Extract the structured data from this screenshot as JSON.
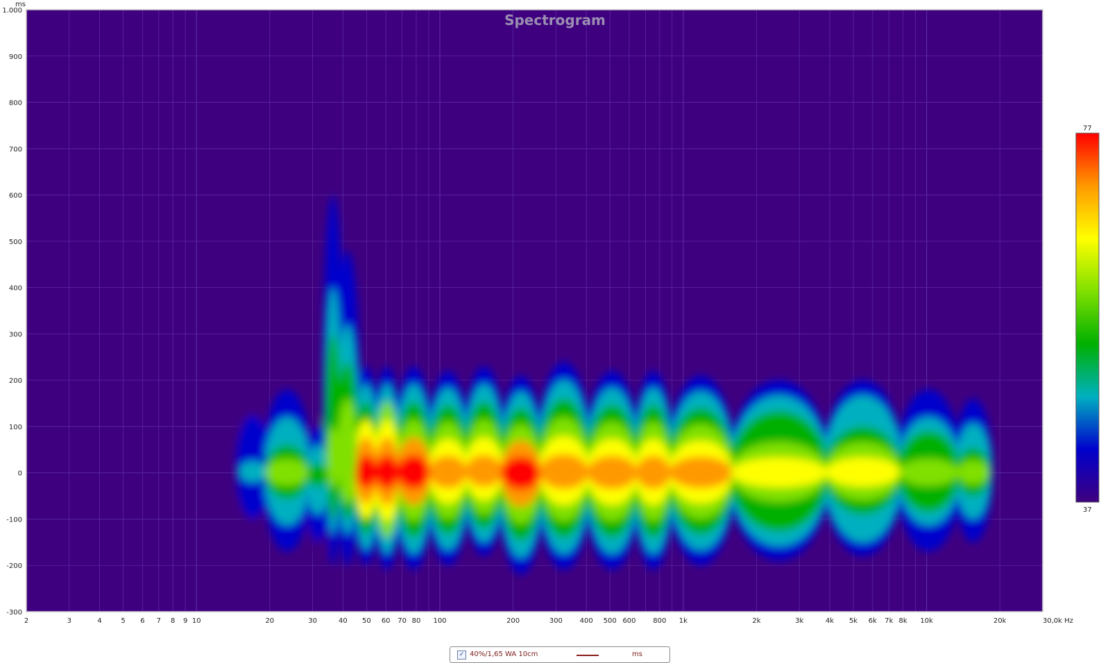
{
  "window": {
    "title": "Spectrogram"
  },
  "colors": {
    "background": "#3f007f",
    "grid": "#5a2aa0",
    "title": "#9a8fb2",
    "curve_legend": "#8b1a1a"
  },
  "chart_data": {
    "type": "heatmap",
    "title": "Spectrogram",
    "xlabel": "Hz",
    "ylabel": "ms",
    "x_scale": "log",
    "xlim": [
      2,
      30000
    ],
    "ylim": [
      -300,
      1000
    ],
    "x_ticks": [
      {
        "v": 2,
        "label": "2"
      },
      {
        "v": 3,
        "label": "3"
      },
      {
        "v": 4,
        "label": "4"
      },
      {
        "v": 5,
        "label": "5"
      },
      {
        "v": 6,
        "label": "6"
      },
      {
        "v": 7,
        "label": "7"
      },
      {
        "v": 8,
        "label": "8"
      },
      {
        "v": 9,
        "label": "9"
      },
      {
        "v": 10,
        "label": "10"
      },
      {
        "v": 20,
        "label": "20"
      },
      {
        "v": 30,
        "label": "30"
      },
      {
        "v": 40,
        "label": "40"
      },
      {
        "v": 50,
        "label": "50"
      },
      {
        "v": 60,
        "label": "60"
      },
      {
        "v": 70,
        "label": "70"
      },
      {
        "v": 80,
        "label": "80"
      },
      {
        "v": 100,
        "label": "100"
      },
      {
        "v": 200,
        "label": "200"
      },
      {
        "v": 300,
        "label": "300"
      },
      {
        "v": 400,
        "label": "400"
      },
      {
        "v": 500,
        "label": "500"
      },
      {
        "v": 600,
        "label": "600"
      },
      {
        "v": 800,
        "label": "800"
      },
      {
        "v": 1000,
        "label": "1k"
      },
      {
        "v": 2000,
        "label": "2k"
      },
      {
        "v": 3000,
        "label": "3k"
      },
      {
        "v": 4000,
        "label": "4k"
      },
      {
        "v": 5000,
        "label": "5k"
      },
      {
        "v": 6000,
        "label": "6k"
      },
      {
        "v": 7000,
        "label": "7k"
      },
      {
        "v": 8000,
        "label": "8k"
      },
      {
        "v": 10000,
        "label": "10k"
      },
      {
        "v": 20000,
        "label": "20k"
      },
      {
        "v": 30000,
        "label": "30,0k Hz"
      }
    ],
    "y_ticks": [
      {
        "v": 1000,
        "label": "1.000"
      },
      {
        "v": 900,
        "label": "900"
      },
      {
        "v": 800,
        "label": "800"
      },
      {
        "v": 700,
        "label": "700"
      },
      {
        "v": 600,
        "label": "600"
      },
      {
        "v": 500,
        "label": "500"
      },
      {
        "v": 400,
        "label": "400"
      },
      {
        "v": 300,
        "label": "300"
      },
      {
        "v": 200,
        "label": "200"
      },
      {
        "v": 100,
        "label": "100"
      },
      {
        "v": 0,
        "label": "0"
      },
      {
        "v": -100,
        "label": "-100"
      },
      {
        "v": -200,
        "label": "-200"
      },
      {
        "v": -300,
        "label": "-300"
      }
    ],
    "colorbar": {
      "min": 37,
      "max": 77,
      "min_label": "37",
      "max_label": "77",
      "stops": [
        "#3f007f",
        "#0000cc",
        "#00b0c0",
        "#00b000",
        "#80e000",
        "#ffff00",
        "#ff9900",
        "#ff0000"
      ]
    },
    "energy": {
      "freq_range": [
        15,
        18000
      ],
      "time_center": 0,
      "level_by_freq": [
        {
          "f": 15,
          "level": 46,
          "up": 150,
          "down": 120
        },
        {
          "f": 25,
          "level": 58,
          "up": 180,
          "down": 170
        },
        {
          "f": 33,
          "level": 52,
          "up": 120,
          "down": 180
        },
        {
          "f": 36,
          "level": 60,
          "up": 600,
          "down": 200
        },
        {
          "f": 41,
          "level": 62,
          "up": 480,
          "down": 200
        },
        {
          "f": 50,
          "level": 76,
          "up": 230,
          "down": 200
        },
        {
          "f": 60,
          "level": 77,
          "up": 230,
          "down": 210
        },
        {
          "f": 75,
          "level": 75,
          "up": 230,
          "down": 210
        },
        {
          "f": 110,
          "level": 70,
          "up": 220,
          "down": 200
        },
        {
          "f": 150,
          "level": 73,
          "up": 230,
          "down": 180
        },
        {
          "f": 215,
          "level": 75,
          "up": 210,
          "down": 220
        },
        {
          "f": 310,
          "level": 74,
          "up": 240,
          "down": 210
        },
        {
          "f": 530,
          "level": 72,
          "up": 220,
          "down": 210
        },
        {
          "f": 780,
          "level": 72,
          "up": 220,
          "down": 210
        },
        {
          "f": 1000,
          "level": 70,
          "up": 210,
          "down": 200
        },
        {
          "f": 2500,
          "level": 66,
          "up": 200,
          "down": 190
        },
        {
          "f": 6000,
          "level": 64,
          "up": 200,
          "down": 180
        },
        {
          "f": 10000,
          "level": 60,
          "up": 180,
          "down": 170
        },
        {
          "f": 18000,
          "level": 58,
          "up": 160,
          "down": 150
        }
      ]
    }
  },
  "legend": {
    "checked": true,
    "name": "40%/1,65 WA 10cm",
    "unit": "ms"
  }
}
